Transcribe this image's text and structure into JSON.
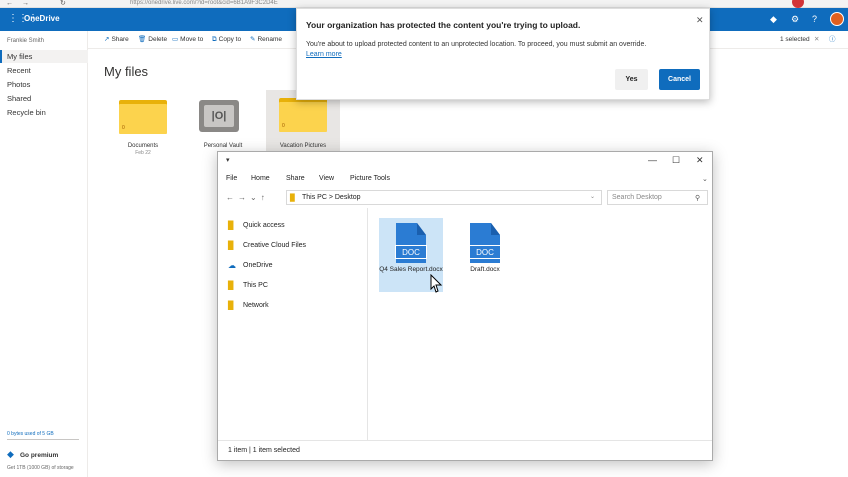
{
  "browser": {
    "url": "https://onedrive.live.com/?id=root&cid=6B1A9F3C2D4E"
  },
  "header": {
    "app_name": "OneDrive",
    "waffle_icon": "waffle-icon",
    "help": "?"
  },
  "left_nav": {
    "user": "Frankie Smith",
    "items": [
      {
        "label": "My files"
      },
      {
        "label": "Recent"
      },
      {
        "label": "Photos"
      },
      {
        "label": "Shared"
      },
      {
        "label": "Recycle bin"
      }
    ],
    "storage": "0 bytes used of 5 GB",
    "premium_label": "Go premium",
    "premium_sub": "Get 1TB (1000 GB) of storage"
  },
  "command_bar": {
    "share": "Share",
    "delete": "Delete",
    "move_to": "Move to",
    "copy_to": "Copy to",
    "rename": "Rename",
    "selected": "1 selected"
  },
  "main": {
    "title": "My files",
    "tiles": [
      {
        "label": "Documents",
        "date": "Feb 22",
        "count": "0"
      },
      {
        "label": "Personal Vault"
      },
      {
        "label": "Vacation Pictures",
        "count": "0"
      }
    ]
  },
  "alert": {
    "title": "Your organization has protected the content you're trying to upload.",
    "message": "You're about to upload protected content to an unprotected location. To proceed, you must submit an override.",
    "link": "Learn more",
    "yes": "Yes",
    "cancel": "Cancel",
    "close": "✕"
  },
  "explorer": {
    "ribbon_tabs": [
      "File",
      "Home",
      "Share",
      "View",
      "Picture Tools"
    ],
    "address": "This PC  >  Desktop",
    "search_placeholder": "Search Desktop",
    "sidebar": [
      {
        "label": "Quick access"
      },
      {
        "label": "Creative Cloud Files"
      },
      {
        "label": "OneDrive"
      },
      {
        "label": "This PC"
      },
      {
        "label": "Network"
      }
    ],
    "files": [
      {
        "name": "Q4 Sales Report.docx",
        "badge": "DOC"
      },
      {
        "name": "Draft.docx",
        "badge": "DOC"
      }
    ],
    "status": "1 item   |   1 item selected"
  },
  "colors": {
    "accent": "#0f6cbd",
    "folder": "#fcd34d",
    "doc": "#2b7cd3"
  }
}
